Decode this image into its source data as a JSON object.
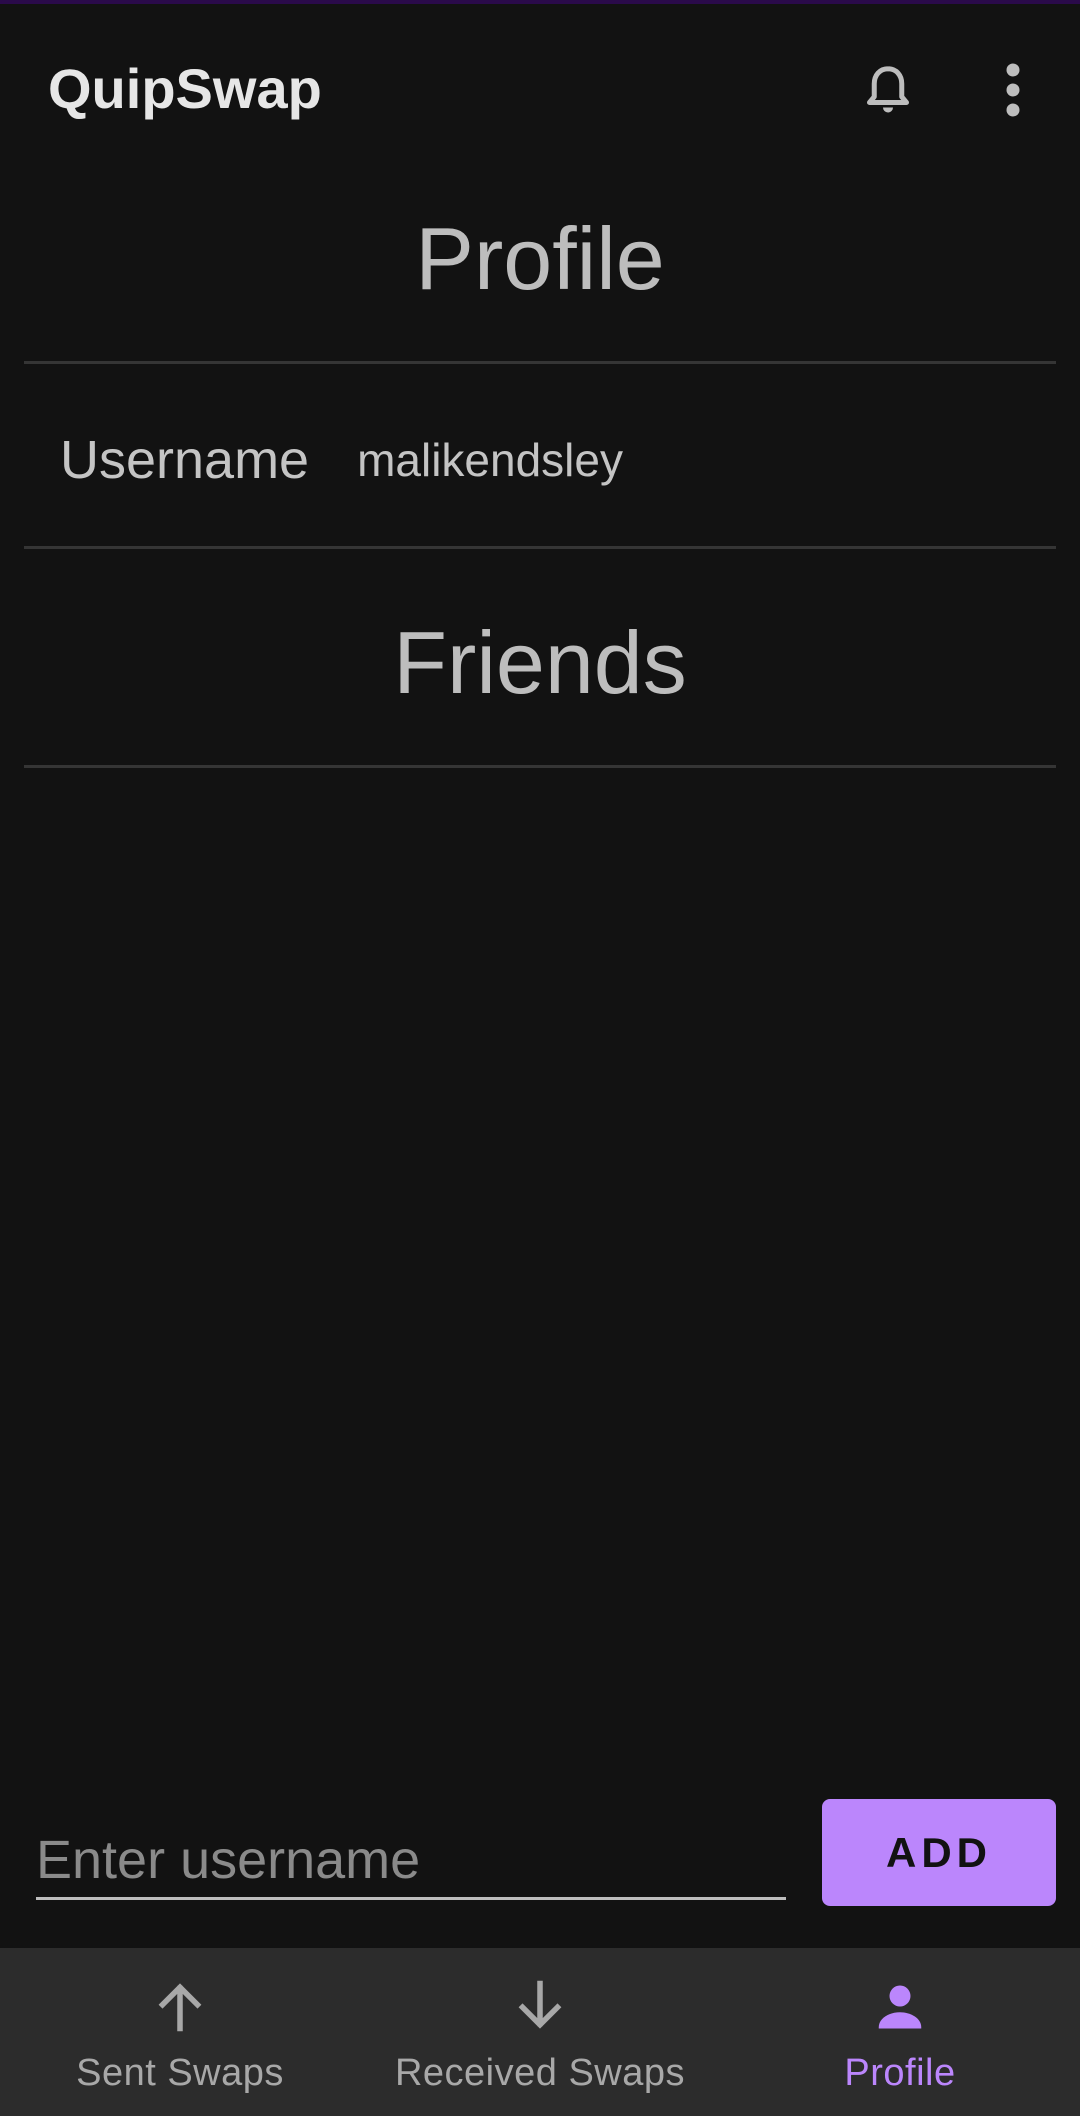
{
  "app": {
    "title": "QuipSwap"
  },
  "profile": {
    "heading": "Profile",
    "username_label": "Username",
    "username_value": "malikendsley"
  },
  "friends": {
    "heading": "Friends",
    "items": []
  },
  "add_friend": {
    "placeholder": "Enter username",
    "value": "",
    "button_label": "ADD"
  },
  "bottom_nav": {
    "items": [
      {
        "label": "Sent Swaps",
        "icon": "arrow-up-icon",
        "active": false
      },
      {
        "label": "Received Swaps",
        "icon": "arrow-down-icon",
        "active": false
      },
      {
        "label": "Profile",
        "icon": "person-icon",
        "active": true
      }
    ]
  },
  "colors": {
    "background": "#121212",
    "accent": "#bb86fc",
    "nav_background": "#2c2c2c",
    "text_primary": "#e6e6e6",
    "text_secondary": "#bdbdbd"
  }
}
